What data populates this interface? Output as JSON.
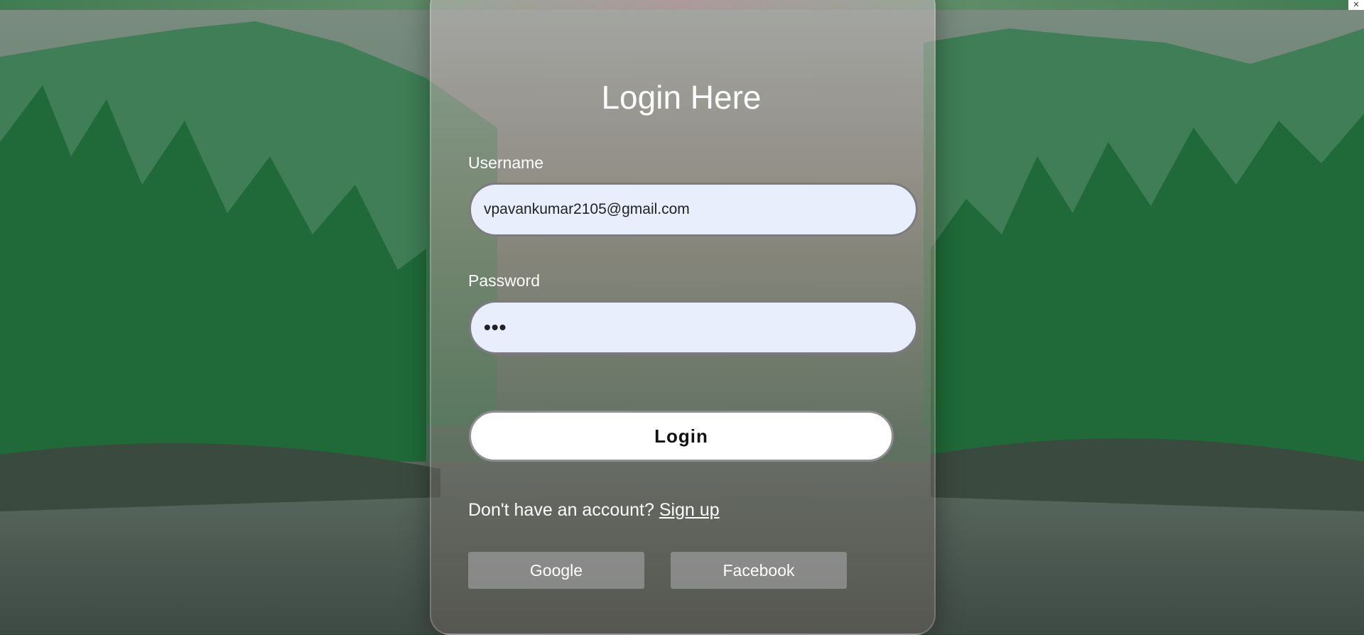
{
  "page": {
    "title": "Login Here"
  },
  "form": {
    "username_label": "Username",
    "username_value": "vpavankumar2105@gmail.com",
    "password_label": "Password",
    "password_value": "•••",
    "login_label": "Login",
    "signup_prompt": "Don't have an account?",
    "signup_link": "Sign up"
  },
  "social": {
    "google_label": "Google",
    "facebook_label": "Facebook"
  },
  "icons": {
    "corner": "close-icon"
  }
}
